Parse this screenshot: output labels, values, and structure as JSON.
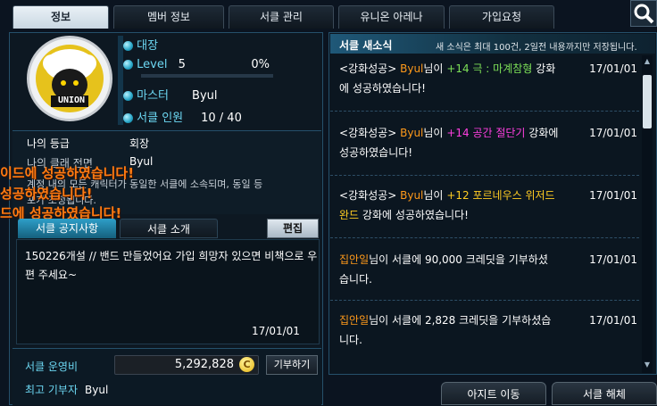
{
  "tabs": [
    {
      "label": "정보"
    },
    {
      "label": "멤버 정보"
    },
    {
      "label": "서클 관리"
    },
    {
      "label": "유니온 아레나"
    },
    {
      "label": "가입요청"
    }
  ],
  "emblem_text": "UNION",
  "info": {
    "title_label": "대장",
    "level_label": "Level",
    "level_value": "5",
    "level_percent": "0%",
    "level_progress": 0,
    "master_label": "마스터",
    "master_value": "Byul",
    "members_label": "서클 인원",
    "members_value": "10 / 40"
  },
  "rank": {
    "label": "나의 등급",
    "value": "회장",
    "class_label": "나의 클래 전면",
    "class_value": "Byul"
  },
  "intro_text": "계정 내의 모든 캐릭터가 동일한 서클에 소속되며, 동일 등",
  "intro_text2": "포가 조정됩니다.",
  "overlay": [
    "이드에 성공하였습니다!",
    "성공하였습니다!",
    "드에 성공하였습니다!"
  ],
  "notice": {
    "tab_notice": "서클 공지사항",
    "tab_intro": "서클 소개",
    "edit_label": "편집",
    "text": "150226개설 // 밴드 만들었어요 가입 희망자 있으면 비책으로 우편 주세요~",
    "date": "17/01/01"
  },
  "funds": {
    "label": "서클 운영비",
    "value": "5,292,828",
    "coin": "C",
    "donate_label": "기부하기",
    "top_label": "최고 기부자",
    "top_value": "Byul"
  },
  "news": {
    "title": "서클 새소식",
    "notice": "새 소식은 최대 100건, 2일전 내용까지만 저장됩니다.",
    "items": [
      {
        "prefix": "<강화성공>",
        "name": "Byul",
        "mid": "님이",
        "item": "+14 극 : 마계참형",
        "suffix": "강화",
        "line2": "에 성공하였습니다!",
        "date": "17/01/01"
      },
      {
        "prefix": "<강화성공>",
        "name": "Byul",
        "mid": "님이",
        "item": "+14 공간 절단기",
        "suffix": "강화에",
        "line2": "성공하였습니다!",
        "date": "17/01/01"
      },
      {
        "prefix": "<강화성공>",
        "name": "Byul",
        "mid": "님이",
        "item": "+12 포르네우스 위저드",
        "line2a": "완드",
        "line2": "강화에 성공하였습니다!",
        "date": "17/01/01"
      },
      {
        "name": "집안일",
        "text": "님이 서클에 90,000 크레딧을 기부하셨",
        "line2": "습니다.",
        "date": "17/01/01"
      },
      {
        "name": "집안일",
        "text": "님이 서클에 2,828 크레딧을 기부하셨습",
        "line2": "니다.",
        "date": "17/01/01"
      }
    ]
  },
  "bottom": {
    "hideout": "아지트 이동",
    "disband": "서클 해체"
  }
}
